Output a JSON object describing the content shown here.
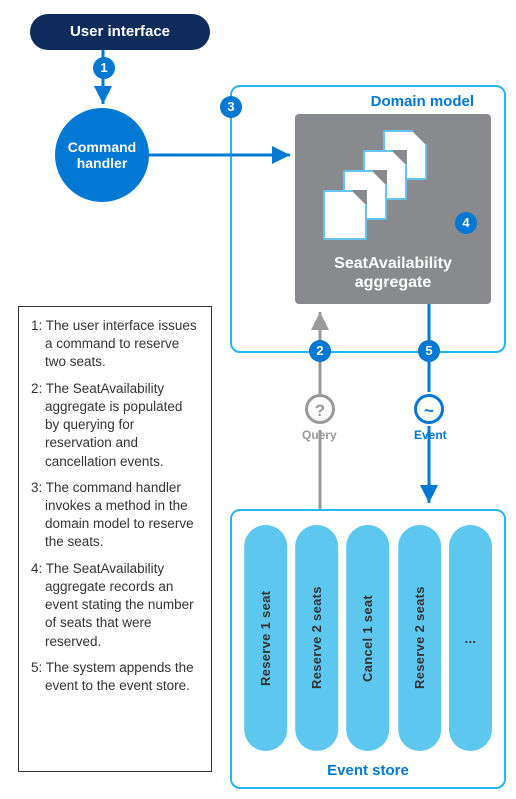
{
  "title": {
    "user_interface": "User interface"
  },
  "nodes": {
    "command_handler": {
      "line1": "Command",
      "line2": "handler"
    },
    "domain_model_title": "Domain model",
    "aggregate": {
      "line1": "SeatAvailability",
      "line2": "aggregate"
    },
    "event_store_title": "Event store"
  },
  "steps": {
    "s1": "1",
    "s2": "2",
    "s3": "3",
    "s4": "4",
    "s5": "5"
  },
  "edges": {
    "query_symbol": "?",
    "query_label": "Query",
    "event_symbol": "~",
    "event_label": "Event"
  },
  "event_store": {
    "pills": [
      "Reserve 1 seat",
      "Reserve 2 seats",
      "Cancel 1 seat",
      "Reserve 2 seats",
      "..."
    ]
  },
  "legend": {
    "l1": "1: The user interface issues a command to reserve two seats.",
    "l2": "2: The SeatAvailability aggregate is populated by querying for reservation and cancellation events.",
    "l3": "3: The command handler invokes a method in the domain model to reserve the seats.",
    "l4": "4: The SeatAvailability aggregate records an event stating the number of seats that were reserved.",
    "l5": "5: The system appends the event to the event store."
  }
}
